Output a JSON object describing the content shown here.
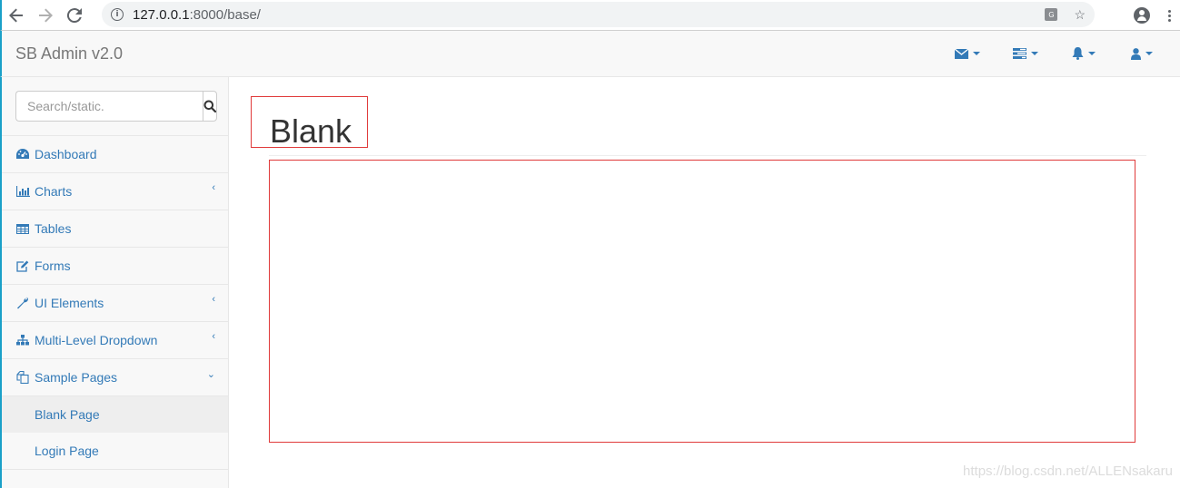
{
  "browser": {
    "url_host": "127.0.0.1",
    "url_rest": ":8000/base/"
  },
  "navbar": {
    "brand": "SB Admin v2.0",
    "top_links": [
      {
        "icon": "envelope-icon"
      },
      {
        "icon": "tasks-icon"
      },
      {
        "icon": "bell-icon"
      },
      {
        "icon": "user-icon"
      }
    ]
  },
  "sidebar": {
    "search_placeholder": "Search/static.",
    "items": [
      {
        "label": "Dashboard",
        "icon": "dashboard-icon",
        "arrow": ""
      },
      {
        "label": "Charts",
        "icon": "bar-chart-icon",
        "arrow": "‹"
      },
      {
        "label": "Tables",
        "icon": "table-icon",
        "arrow": ""
      },
      {
        "label": "Forms",
        "icon": "edit-icon",
        "arrow": ""
      },
      {
        "label": "UI Elements",
        "icon": "wrench-icon",
        "arrow": "‹"
      },
      {
        "label": "Multi-Level Dropdown",
        "icon": "sitemap-icon",
        "arrow": "‹"
      },
      {
        "label": "Sample Pages",
        "icon": "files-icon",
        "arrow": "⌄"
      }
    ],
    "sub_items": [
      {
        "label": "Blank Page",
        "active": true
      },
      {
        "label": "Login Page",
        "active": false
      }
    ]
  },
  "main": {
    "page_header": "Blank"
  },
  "watermark": "https://blog.csdn.net/ALLENsakaru"
}
